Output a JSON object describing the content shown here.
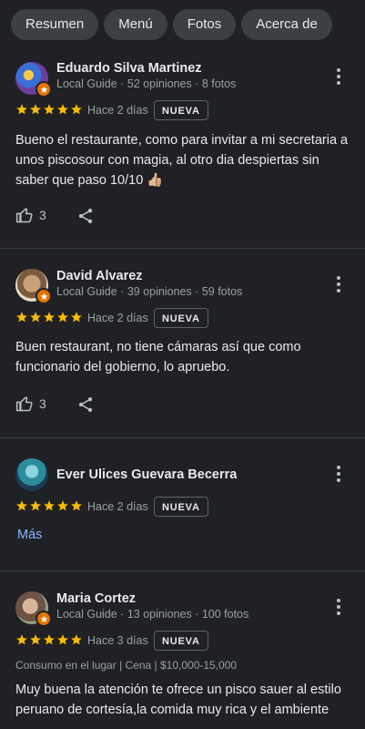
{
  "tabs": [
    "Resumen",
    "Menú",
    "Fotos",
    "Acerca de"
  ],
  "colors": {
    "background": "#202124",
    "star": "#fbbc04",
    "link": "#8ab4f8",
    "badge": "#e37400"
  },
  "reviews": [
    {
      "name": "Eduardo Silva Martinez",
      "meta": "Local Guide · 52 opiniones · 8 fotos",
      "rating": 5,
      "when": "Hace 2 días",
      "badge": "NUEVA",
      "text": "Bueno el restaurante, como para invitar a mi secretaria a unos piscosour con magia, al otro dia despiertas sin saber que paso 10/10 👍🏼",
      "likes": "3"
    },
    {
      "name": "David Alvarez",
      "meta": "Local Guide · 39 opiniones · 59 fotos",
      "rating": 5,
      "when": "Hace 2 días",
      "badge": "NUEVA",
      "text": "Buen restaurant, no tiene cámaras así que como funcionario del gobierno, lo apruebo.",
      "likes": "3"
    },
    {
      "name": "Ever Ulices Guevara Becerra",
      "rating": 5,
      "when": "Hace 2 días",
      "badge": "NUEVA",
      "more_link": "Más"
    },
    {
      "name": "Maria Cortez",
      "meta": "Local Guide · 13 opiniones · 100 fotos",
      "rating": 5,
      "when": "Hace 3 días",
      "badge": "NUEVA",
      "details": "Consumo en el lugar  |  Cena  |  $10,000-15,000",
      "text": "Muy buena la atención te ofrece un pisco sauer al estilo peruano de cortesía,la comida muy rica y el ambiente"
    }
  ]
}
